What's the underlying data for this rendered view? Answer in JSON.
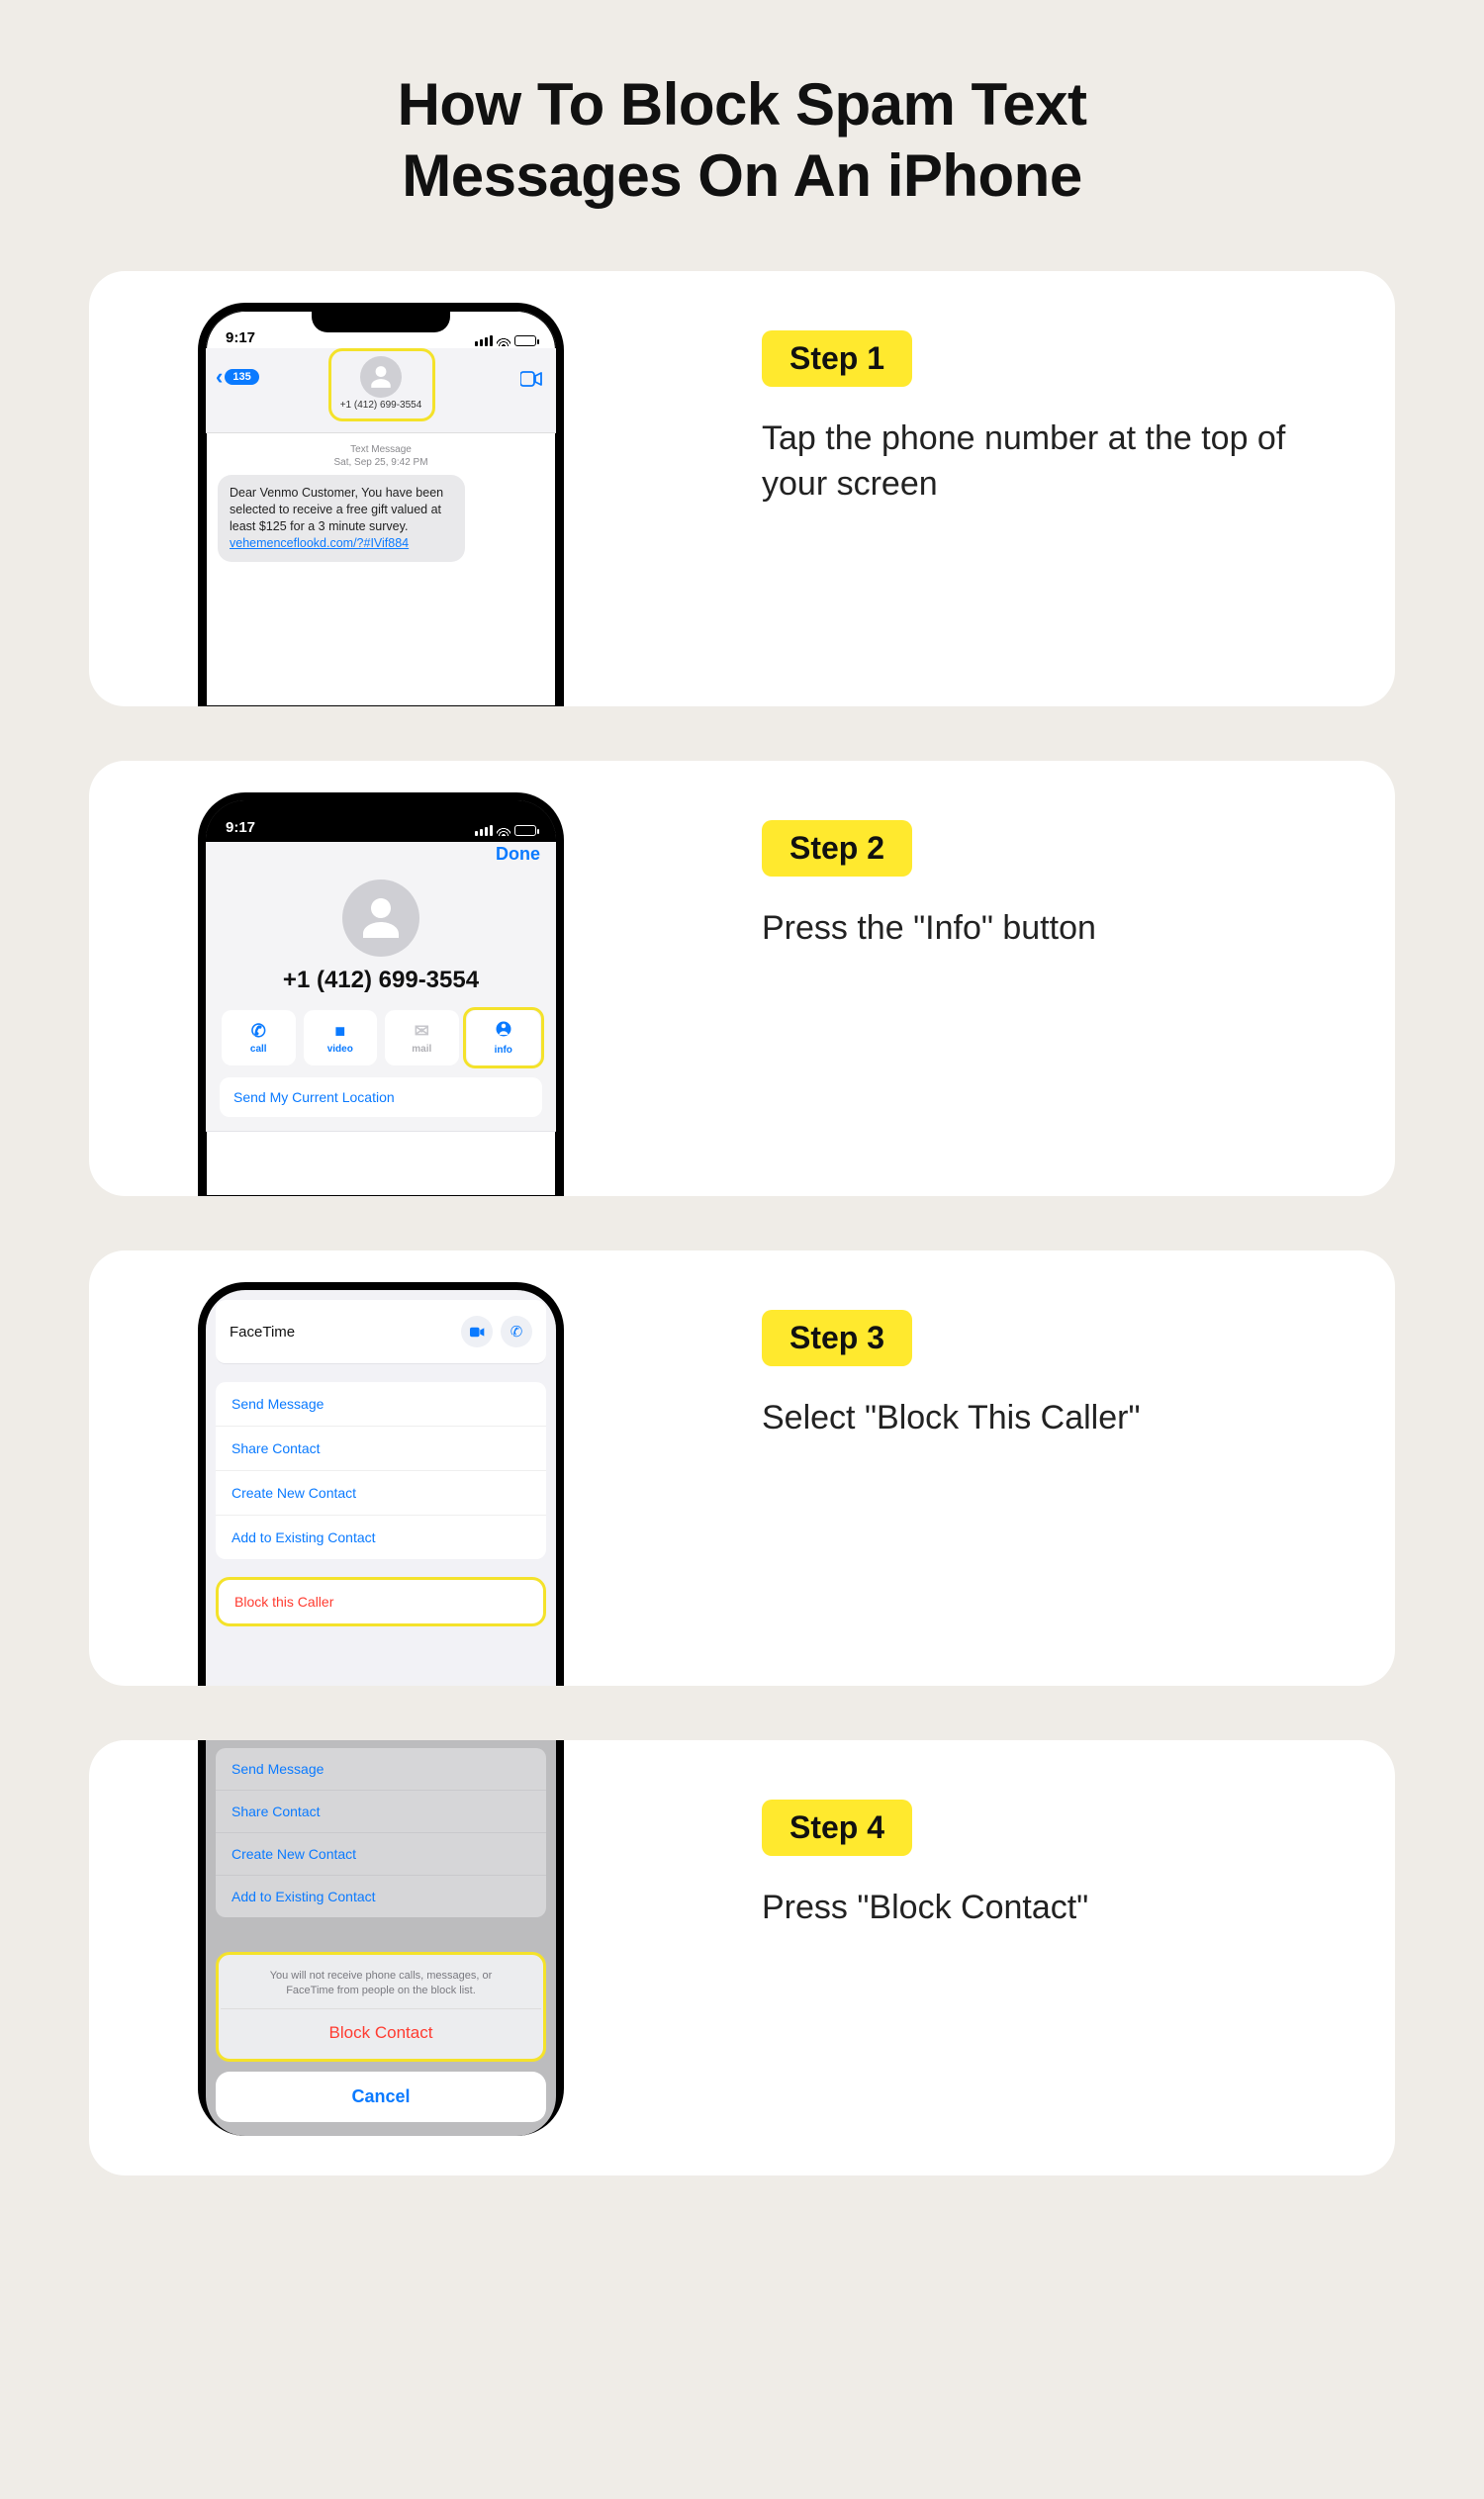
{
  "title": "How To Block Spam Text Messages On An iPhone",
  "time": "9:17",
  "phone_number": "+1 (412) 699-3554",
  "steps": {
    "s1": {
      "badge": "Step 1",
      "desc": "Tap the phone number at the top of your screen",
      "back_badge": "135",
      "meta_line1": "Text Message",
      "meta_line2": "Sat, Sep 25, 9:42 PM",
      "bubble_text": "Dear Venmo Customer, You have been selected to receive a free gift valued at least $125 for a 3 minute survey.",
      "bubble_link": "vehemenceflookd.com/?#IVif884"
    },
    "s2": {
      "badge": "Step 2",
      "desc": "Press the \"Info\" button",
      "done": "Done",
      "seg_call": "call",
      "seg_video": "video",
      "seg_mail": "mail",
      "seg_info": "info",
      "loc": "Send My Current Location"
    },
    "s3": {
      "badge": "Step 3",
      "desc": "Select \"Block This Caller\"",
      "facetime": "FaceTime",
      "row1": "Send Message",
      "row2": "Share Contact",
      "row3": "Create New Contact",
      "row4": "Add to Existing Contact",
      "block": "Block this Caller"
    },
    "s4": {
      "badge": "Step 4",
      "desc": "Press \"Block Contact\"",
      "row1": "Send Message",
      "row2": "Share Contact",
      "row3": "Create New Contact",
      "row4": "Add to Existing Contact",
      "hint": "You will not receive phone calls, messages, or FaceTime from people on the block list.",
      "block": "Block Contact",
      "cancel": "Cancel"
    }
  }
}
